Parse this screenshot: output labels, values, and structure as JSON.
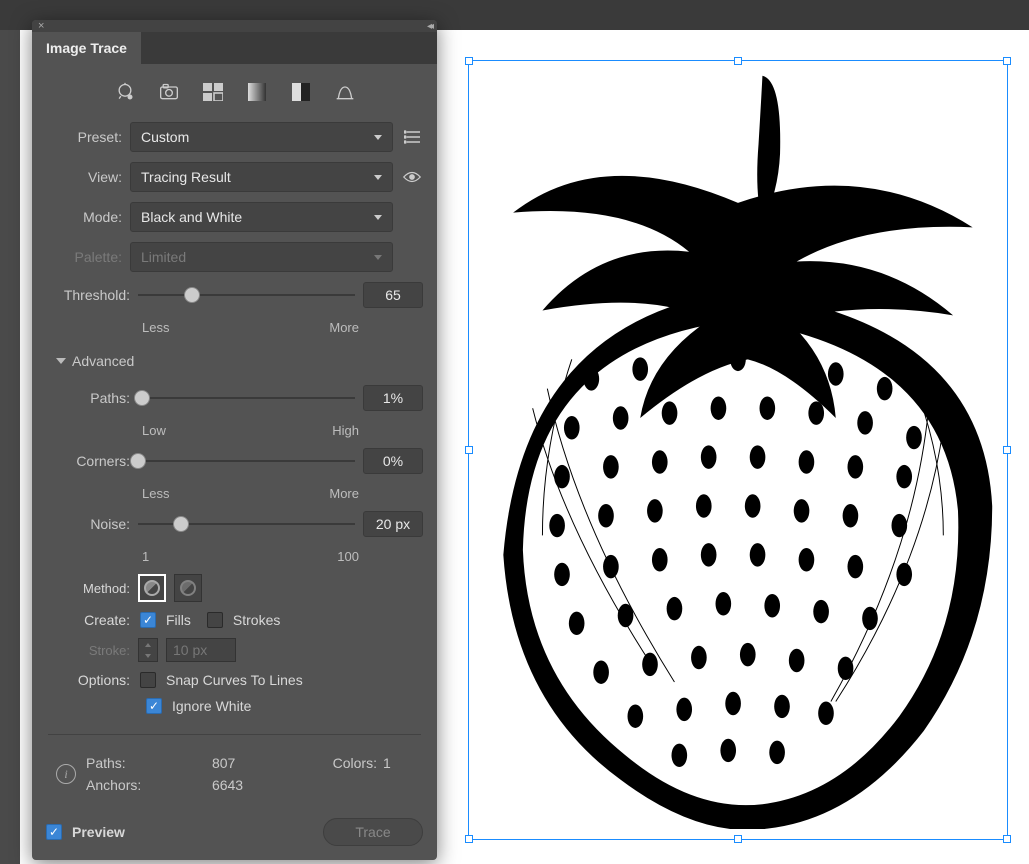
{
  "panel": {
    "title": "Image Trace",
    "preset_label": "Preset:",
    "preset_value": "Custom",
    "view_label": "View:",
    "view_value": "Tracing Result",
    "mode_label": "Mode:",
    "mode_value": "Black and White",
    "palette_label": "Palette:",
    "palette_value": "Limited",
    "threshold_label": "Threshold:",
    "threshold_value": "65",
    "threshold_min": "Less",
    "threshold_max": "More",
    "advanced_label": "Advanced",
    "paths_label": "Paths:",
    "paths_value": "1%",
    "paths_min": "Low",
    "paths_max": "High",
    "corners_label": "Corners:",
    "corners_value": "0%",
    "corners_min": "Less",
    "corners_max": "More",
    "noise_label": "Noise:",
    "noise_value": "20 px",
    "noise_min": "1",
    "noise_max": "100",
    "method_label": "Method:",
    "create_label": "Create:",
    "fills_label": "Fills",
    "strokes_label": "Strokes",
    "stroke_label": "Stroke:",
    "stroke_value": "10 px",
    "options_label": "Options:",
    "snap_label": "Snap Curves To Lines",
    "ignore_label": "Ignore White",
    "stats_paths_label": "Paths:",
    "stats_paths_value": "807",
    "stats_colors_label": "Colors:",
    "stats_colors_value": "1",
    "stats_anchors_label": "Anchors:",
    "stats_anchors_value": "6643",
    "preview_label": "Preview",
    "trace_label": "Trace"
  }
}
